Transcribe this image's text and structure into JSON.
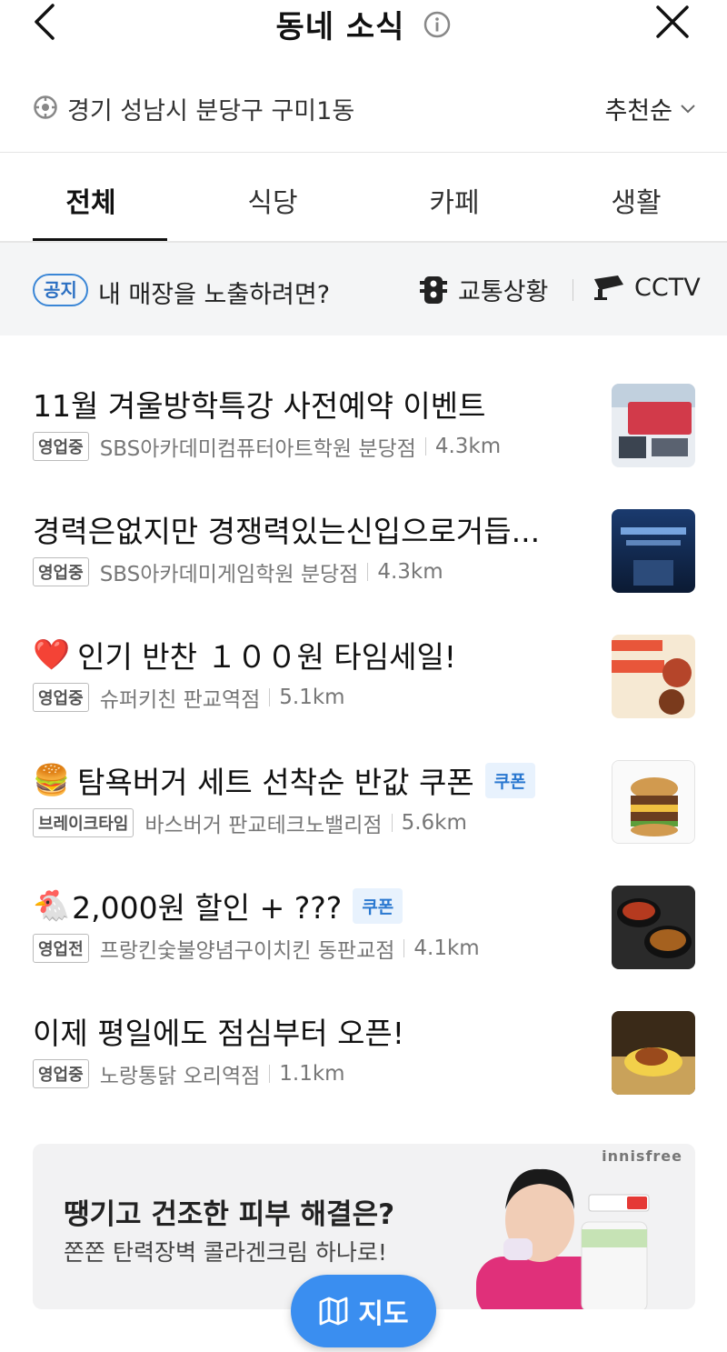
{
  "header": {
    "title": "동네 소식"
  },
  "location": {
    "text": "경기 성남시 분당구 구미1동",
    "sort_label": "추천순"
  },
  "tabs": [
    {
      "label": "전체",
      "active": true
    },
    {
      "label": "식당",
      "active": false
    },
    {
      "label": "카페",
      "active": false
    },
    {
      "label": "생활",
      "active": false
    }
  ],
  "notice": {
    "badge": "공지",
    "text": "내 매장을 노출하려면?",
    "traffic_label": "교통상황",
    "cctv_label": "CCTV"
  },
  "items": [
    {
      "title": "11월 겨울방학특강 사전예약 이벤트",
      "status": "영업중",
      "store": "SBS아카데미컴퓨터아트학원 분당점",
      "distance": "4.3km",
      "coupon": ""
    },
    {
      "title": "경력은없지만 경쟁력있는신입으로거듭...",
      "status": "영업중",
      "store": "SBS아카데미게임학원 분당점",
      "distance": "4.3km",
      "coupon": ""
    },
    {
      "emoji": "❤️",
      "title": "인기 반찬 １００원 타임세일!",
      "status": "영업중",
      "store": "슈퍼키친 판교역점",
      "distance": "5.1km",
      "coupon": ""
    },
    {
      "emoji": "🍔",
      "title": "탐욕버거 세트 선착순 반값 쿠폰",
      "status": "브레이크타임",
      "store": "바스버거 판교테크노밸리점",
      "distance": "5.6km",
      "coupon": "쿠폰"
    },
    {
      "emoji": "🐔",
      "title": "2,000원 할인 + ???",
      "status": "영업전",
      "store": "프랑킨숯불양념구이치킨 동판교점",
      "distance": "4.1km",
      "coupon": "쿠폰"
    },
    {
      "title": "이제 평일에도 점심부터 오픈!",
      "status": "영업중",
      "store": "노랑통닭 오리역점",
      "distance": "1.1km",
      "coupon": ""
    }
  ],
  "ad": {
    "title": "땡기고 건조한 피부 해결은?",
    "subtitle": "쫀쫀 탄력장벽 콜라겐크림 하나로!",
    "brand": "innisfree"
  },
  "map_button": {
    "label": "지도"
  },
  "colors": {
    "accent": "#3a8ef0",
    "coupon_bg": "#e8f2fd",
    "notice_bg": "#f4f5f6"
  }
}
